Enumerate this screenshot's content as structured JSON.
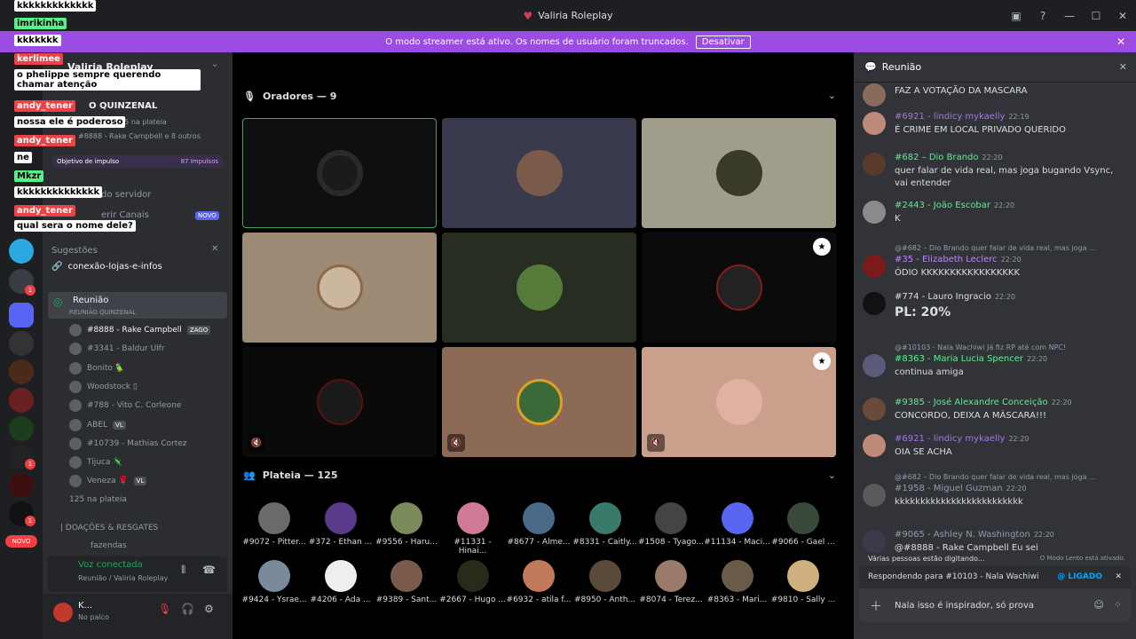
{
  "window": {
    "title": "Valiria Roleplay"
  },
  "banner": {
    "text": "O modo streamer está ativo. Os nomes de usuário foram truncados.",
    "button": "Desativar"
  },
  "overlay": [
    {
      "text": "kkkkkkkkkkkkk",
      "bg": "#ffffff",
      "color": "#000000"
    },
    {
      "text": "imrikinha",
      "bg": "#57f287",
      "color": "#000000"
    },
    {
      "text": "kkkkkkk",
      "bg": "#ffffff",
      "color": "#000000"
    },
    {
      "text": "kerlimee",
      "bg": "#ed4245",
      "color": "#ffffff"
    },
    {
      "text": "o phelippe sempre querendo chamar atenção",
      "bg": "#ffffff",
      "color": "#000000"
    },
    {
      "text": "andy_tener",
      "bg": "#ed4245",
      "color": "#ffffff"
    },
    {
      "text": "nossa ele é poderoso",
      "bg": "#ffffff",
      "color": "#000000"
    },
    {
      "text": "andy_tener",
      "bg": "#ed4245",
      "color": "#ffffff"
    },
    {
      "text": "ne",
      "bg": "#ffffff",
      "color": "#000000"
    },
    {
      "text": "Mkzr",
      "bg": "#57f287",
      "color": "#000000"
    },
    {
      "text": "kkkkkkkkkkkkkk",
      "bg": "#ffffff",
      "color": "#000000"
    },
    {
      "text": "andy_tener",
      "bg": "#ed4245",
      "color": "#ffffff"
    },
    {
      "text": "qual sera o nome dele?",
      "bg": "#ffffff",
      "color": "#000000"
    }
  ],
  "sidebar": {
    "server_name": "Valiria Roleplay",
    "event_title": "O QUINZENAL",
    "event_plateia": "125 na plateia",
    "event_speakers": "#8888 - Rake Campbell e 8 outros",
    "boost": "Objetivo de impulso",
    "boost_count": "87 Impulsos",
    "servidor": "do servidor",
    "canais": "erir Canais",
    "novo": "NOVO",
    "sugestoes": "Sugestões",
    "loja": "conexão-lojas-e-infos",
    "stage_channel": "Reunião",
    "stage_sub": "REUNIÃO QUINZENAL",
    "members": [
      {
        "name": "#8888 - Rake Campbell",
        "tag": "ZAGO"
      },
      {
        "name": "#3341 - Baldur Ulfr",
        "tag": ""
      },
      {
        "name": "Bonito 🦜",
        "tag": ""
      },
      {
        "name": "Woodstock ▯",
        "tag": ""
      },
      {
        "name": "#788 - Vito C. Corleone",
        "tag": ""
      },
      {
        "name": "ABEL",
        "tag": "VL"
      },
      {
        "name": "#10739 - Mathias Cortez",
        "tag": ""
      },
      {
        "name": "Tijuca 🦎",
        "tag": ""
      },
      {
        "name": "Veneza 🌹",
        "tag": "VL"
      }
    ],
    "plateia": "125 na plateia",
    "doacoes": "| DOAÇÕES & RESGATES",
    "fazendas": "fazendas",
    "voice_status": "Voz conectada",
    "voice_channel": "Reunião / Valiria Roleplay",
    "user": "K...",
    "user_status": "No palco"
  },
  "stage": {
    "speakers_title": "Oradores — 9",
    "audience_title": "Plateia — 125",
    "audience": [
      "#9072 - Pitter...",
      "#372 - Ethan ...",
      "#9556 - Haru...",
      "#11331 - Hinai...",
      "#8677 - Alme...",
      "#8331 - Caitly...",
      "#1508 - Tyago...",
      "#11134 - Maci...",
      "#9066 - Gael ...",
      "#9424 - Ysrae...",
      "#4206 - Ada ...",
      "#9389 - Sant...",
      "#2667 - Hugo ...",
      "#6932 - atila f...",
      "#8950 - Anth...",
      "#8074 - Terez...",
      "#8363 - Mari...",
      "#9810 - Sally ..."
    ]
  },
  "chat": {
    "title": "Reunião",
    "messages": [
      {
        "author": "",
        "time": "",
        "text": "FAZ A VOTAÇÃO DA MASCARA",
        "reply": ""
      },
      {
        "author": "#6921 - lindicy mykaelly",
        "time": "22:19",
        "text": "É CRIME EM LOCAL PRIVADO QUERIDO",
        "reply": ""
      },
      {
        "author": "#682 – Dio Brando",
        "time": "22:20",
        "text": "quer falar de vida real, mas joga bugando Vsync, vai entender",
        "reply": ""
      },
      {
        "author": "#2443 - João Escobar",
        "time": "22:20",
        "text": "K",
        "reply": ""
      },
      {
        "author": "#35 - Elizabeth Leclerc",
        "time": "22:20",
        "text": "ÓDIO KKKKKKKKKKKKKKKKK",
        "reply": "@#682 – Dio Brando quer falar de vida real, mas joga ..."
      },
      {
        "author": "#774 - Lauro Ingracio",
        "time": "22:20",
        "text": "PL: 20%",
        "reply": ""
      },
      {
        "author": "#8363 - Maria Lucia Spencer",
        "time": "22:20",
        "text": "continua amiga",
        "reply": "@#10103 - Nala Wachiwi Já fiz RP até com NPC!"
      },
      {
        "author": "#9385 - José Alexandre Conceição",
        "time": "22:20",
        "text": "CONCORDO, DEIXA A MÁSCARA!!!",
        "reply": ""
      },
      {
        "author": "#6921 - lindicy mykaelly",
        "time": "22:20",
        "text": "OIA SE ACHA",
        "reply": ""
      },
      {
        "author": "#1958 - Miguel Guzman",
        "time": "22:20",
        "text": "kkkkkkkkkkkkkkkkkkkkkkkkk",
        "reply": "@#682 – Dio Brando quer falar de vida real, mas joga ..."
      },
      {
        "author": "#9065 - Ashley N. Washington",
        "time": "22:20",
        "text": "@#8888 - Rake Campbell Eu sei",
        "reply": ""
      }
    ],
    "typing": "Várias pessoas estão digitando...",
    "slow": "O Modo Lento está ativado.",
    "replying_to": "Respondendo para #10103 - Nala Wachiwi",
    "ligado": "@ LIGADO",
    "draft": "Nala isso é inspirador, só prova"
  }
}
